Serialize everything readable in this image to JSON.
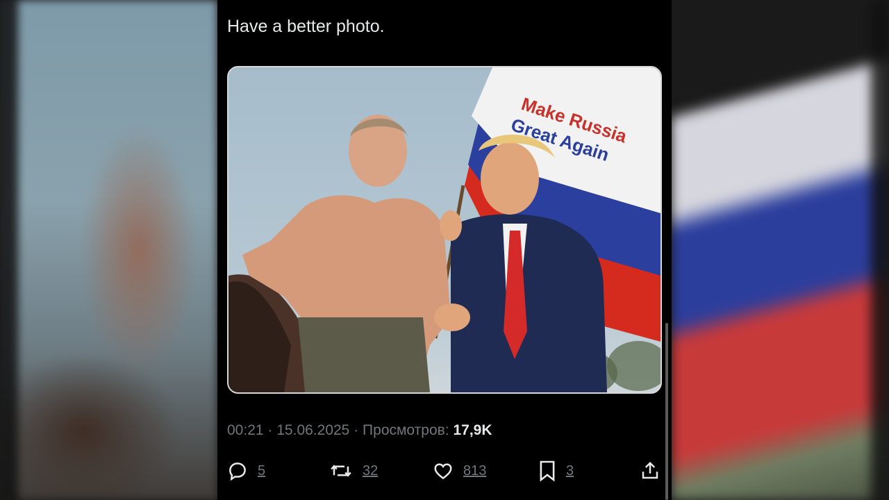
{
  "post": {
    "text": "Have a better photo.",
    "image": {
      "flag_text_line1": "Make Russia",
      "flag_text_line2": "Great Again",
      "flag_colors": [
        "#ffffff",
        "#2b3f9e",
        "#d52b1e"
      ]
    },
    "time": "00:21",
    "separator": "·",
    "date": "15.06.2025",
    "views_label": "Просмотров:",
    "views_count": "17,9K"
  },
  "actions": {
    "replies": {
      "icon": "reply-icon",
      "count": "5"
    },
    "reposts": {
      "icon": "repost-icon",
      "count": "32"
    },
    "likes": {
      "icon": "heart-icon",
      "count": "813"
    },
    "bookmarks": {
      "icon": "bookmark-icon",
      "count": "3"
    },
    "share": {
      "icon": "share-icon"
    }
  },
  "colors": {
    "background": "#000000",
    "text": "#e7e9ea",
    "muted": "#71767b"
  }
}
